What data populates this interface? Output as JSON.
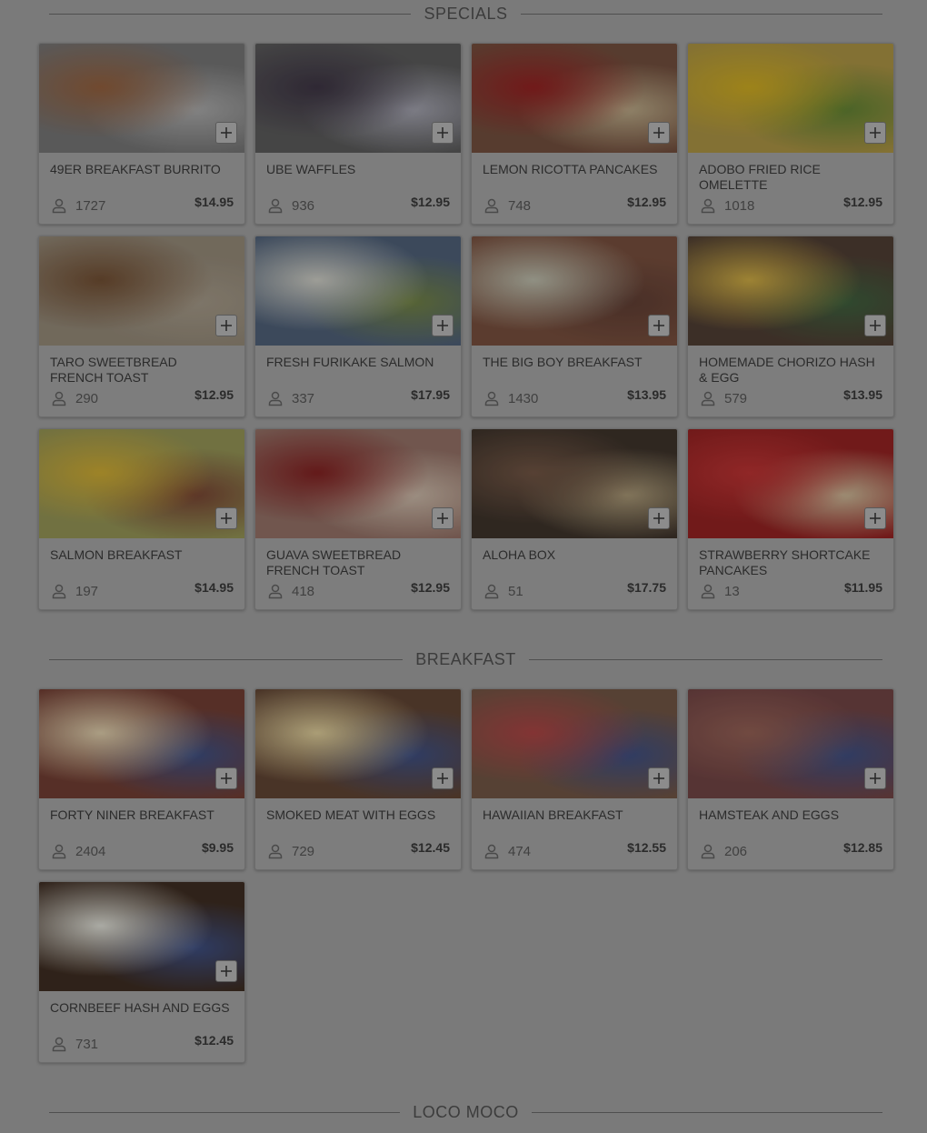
{
  "sections": [
    {
      "title": "SPECIALS",
      "items": [
        {
          "name": "49er BREAKFAST BURRITO",
          "count": "1727",
          "price": "$14.95"
        },
        {
          "name": "UBE WAFFLES",
          "count": "936",
          "price": "$12.95"
        },
        {
          "name": "LEMON RICOTTA PANCAKES",
          "count": "748",
          "price": "$12.95"
        },
        {
          "name": "ADOBO FRIED RICE OMELETTE",
          "count": "1018",
          "price": "$12.95"
        },
        {
          "name": "TARO SWEETBREAD FRENCH TOAST",
          "count": "290",
          "price": "$12.95"
        },
        {
          "name": "FRESH FURIKAKE SALMON",
          "count": "337",
          "price": "$17.95"
        },
        {
          "name": "THE BIG BOY BREAKFAST",
          "count": "1430",
          "price": "$13.95"
        },
        {
          "name": "HOMEMADE CHORIZO HASH & EGG",
          "count": "579",
          "price": "$13.95"
        },
        {
          "name": "SALMON BREAKFAST",
          "count": "197",
          "price": "$14.95"
        },
        {
          "name": "GUAVA SWEETBREAD FRENCH TOAST",
          "count": "418",
          "price": "$12.95"
        },
        {
          "name": "ALOHA BOX",
          "count": "51",
          "price": "$17.75"
        },
        {
          "name": "STRAWBERRY SHORTCAKE PANCAKES",
          "count": "13",
          "price": "$11.95"
        }
      ]
    },
    {
      "title": "BREAKFAST",
      "items": [
        {
          "name": "FORTY NINER BREAKFAST",
          "count": "2404",
          "price": "$9.95"
        },
        {
          "name": "SMOKED MEAT WITH EGGS",
          "count": "729",
          "price": "$12.45"
        },
        {
          "name": "HAWAIIAN BREAKFAST",
          "count": "474",
          "price": "$12.55"
        },
        {
          "name": "HAMSTEAK AND EGGS",
          "count": "206",
          "price": "$12.85"
        },
        {
          "name": "CORNBEEF HASH AND EGGS",
          "count": "731",
          "price": "$12.45"
        }
      ]
    },
    {
      "title": "LOCO MOCO",
      "items": []
    }
  ],
  "icons": {
    "add": "plus-icon",
    "orders": "person-icon"
  },
  "colors": {
    "overlay": "#7a7a7a",
    "text": "#2b2b2b"
  }
}
